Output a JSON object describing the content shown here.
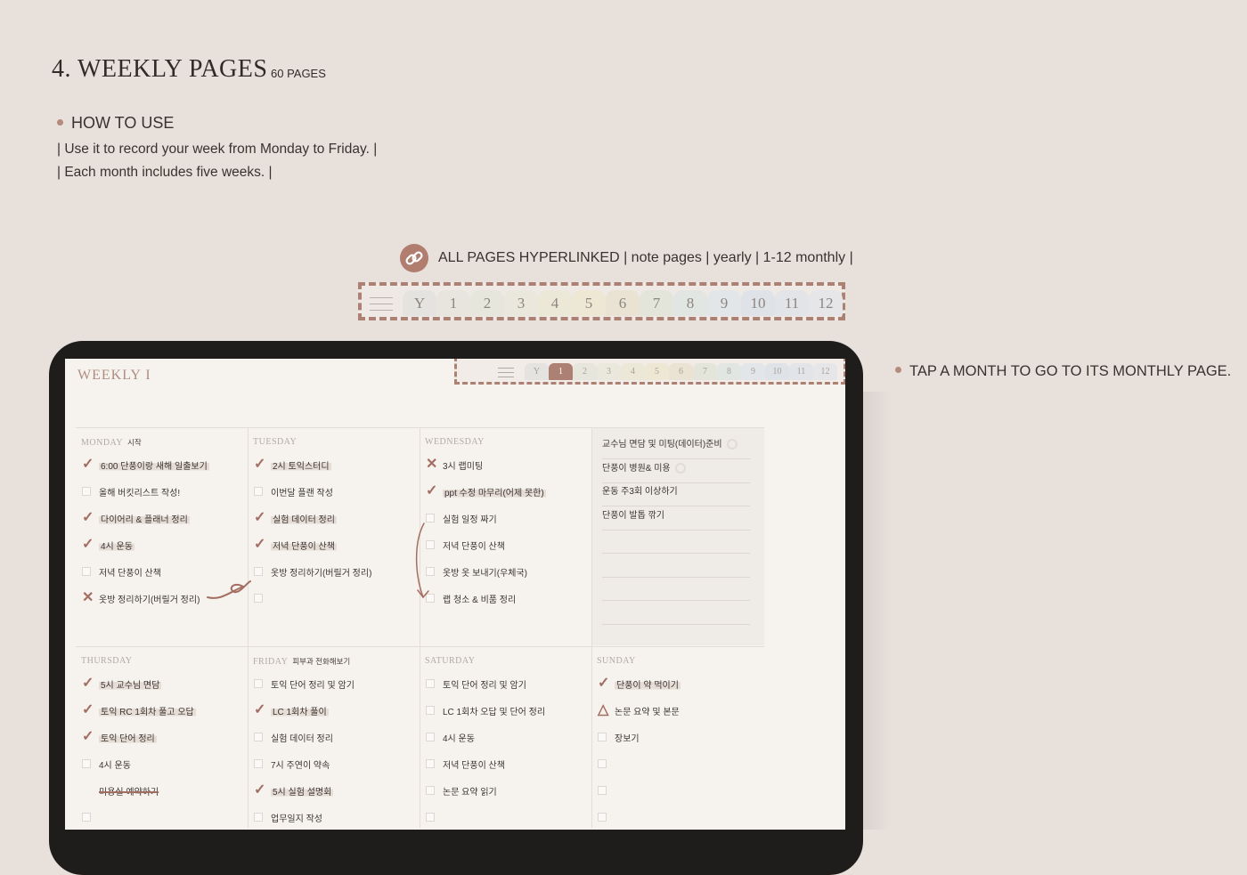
{
  "heading": {
    "title": "4. WEEKLY PAGES",
    "count": "60 PAGES"
  },
  "howto": {
    "label": "HOW TO USE",
    "line1": "| Use it to record your week from Monday to Friday. |",
    "line2": "| Each month includes five weeks. |"
  },
  "hyperlink": {
    "text": "ALL PAGES  HYPERLINKED | note pages | yearly | 1-12 monthly |"
  },
  "tabs": [
    "Y",
    "1",
    "2",
    "3",
    "4",
    "5",
    "6",
    "7",
    "8",
    "9",
    "10",
    "11",
    "12"
  ],
  "tab_colors": [
    "#e5e3e0",
    "#e8e4de",
    "#e6e6dd",
    "#eae7dc",
    "#ece8d8",
    "#ede7d3",
    "#eae3d3",
    "#e4e5da",
    "#e2e6e2",
    "#e3e6e8",
    "#dfe2e6",
    "#e2e4e8",
    "#e6e6e8"
  ],
  "tap_note": "TAP A MONTH TO GO TO ITS MONTHLY PAGE.",
  "screen": {
    "weekly_title": "WEEKLY  I",
    "active_tab": "1",
    "days": [
      {
        "name": "MONDAY",
        "note": "시작",
        "tasks": [
          {
            "text": "6:00 단풍이랑 새해 일출보기",
            "state": "done"
          },
          {
            "text": "올해 버킷리스트 작성!",
            "state": "open"
          },
          {
            "text": "다이어리 & 플래너 정리",
            "state": "done"
          },
          {
            "text": "4시 운동",
            "state": "done"
          },
          {
            "text": "저녁 단풍이 산책",
            "state": "open"
          },
          {
            "text": "옷방 정리하기(버릴거 정리)",
            "state": "cancel"
          }
        ]
      },
      {
        "name": "TUESDAY",
        "note": "",
        "tasks": [
          {
            "text": "2시 토익스터디",
            "state": "done"
          },
          {
            "text": "이번달 플랜 작성",
            "state": "open"
          },
          {
            "text": "실험 데이터 정리",
            "state": "done"
          },
          {
            "text": "저녁 단풍이 산책",
            "state": "done"
          },
          {
            "text": "옷방 정리하기(버릴거 정리)",
            "state": "open"
          },
          {
            "text": "",
            "state": "open"
          }
        ]
      },
      {
        "name": "WEDNESDAY",
        "note": "",
        "tasks": [
          {
            "text": "3시 랩미팅",
            "state": "cancel"
          },
          {
            "text": "ppt 수정 마무리(어제 못한)",
            "state": "done"
          },
          {
            "text": "실험 일정 짜기",
            "state": "open"
          },
          {
            "text": "저녁 단풍이 산책",
            "state": "open"
          },
          {
            "text": "옷방 옷 보내기(우체국)",
            "state": "open"
          },
          {
            "text": "랩 청소 & 비품 정리",
            "state": "open"
          }
        ]
      },
      {
        "name": "THURSDAY",
        "note": "",
        "tasks": [
          {
            "text": "5시 교수님 면담",
            "state": "done"
          },
          {
            "text": "토익 RC 1회차 풀고 오답",
            "state": "done"
          },
          {
            "text": "토익 단어 정리",
            "state": "done"
          },
          {
            "text": "4시 운동",
            "state": "open"
          },
          {
            "text": "미용실 예약하기",
            "state": "strike"
          },
          {
            "text": "",
            "state": "open"
          }
        ]
      },
      {
        "name": "FRIDAY",
        "note": "피부과 전화해보기",
        "tasks": [
          {
            "text": "토익 단어 정리 및 암기",
            "state": "open"
          },
          {
            "text": "LC 1회차 풀이",
            "state": "done"
          },
          {
            "text": "실험 데이터 정리",
            "state": "open"
          },
          {
            "text": "7시 주연이 약속",
            "state": "open"
          },
          {
            "text": "5시 실험 설명회",
            "state": "done"
          },
          {
            "text": "업무일지 작성",
            "state": "open"
          }
        ]
      },
      {
        "name": "SATURDAY",
        "note": "",
        "tasks": [
          {
            "text": "토익 단어 정리 및 암기",
            "state": "open"
          },
          {
            "text": "LC 1회차 오답 및 단어 정리",
            "state": "open"
          },
          {
            "text": "4시 운동",
            "state": "open"
          },
          {
            "text": "저녁 단풍이 산책",
            "state": "open"
          },
          {
            "text": "논문 요약 읽기",
            "state": "open"
          },
          {
            "text": "",
            "state": "open"
          }
        ]
      },
      {
        "name": "SUNDAY",
        "note": "",
        "tasks": [
          {
            "text": "단풍이 약 먹이기",
            "state": "done"
          },
          {
            "text": "논문 요약 및 본문",
            "state": "moved"
          },
          {
            "text": "장보기",
            "state": "open"
          },
          {
            "text": "",
            "state": "open"
          },
          {
            "text": "",
            "state": "open"
          },
          {
            "text": "",
            "state": "open"
          }
        ]
      }
    ],
    "memo": [
      "교수님 면담 및 미팅(데이터)준비",
      "단풍이 병원& 미용",
      "운동 주3회 이상하기",
      "단풍이 발톱 깎기",
      "",
      "",
      "",
      ""
    ]
  },
  "colors": {
    "accent": "#ad8074",
    "background": "#e8e0db",
    "screen": "#f6f3ef"
  }
}
